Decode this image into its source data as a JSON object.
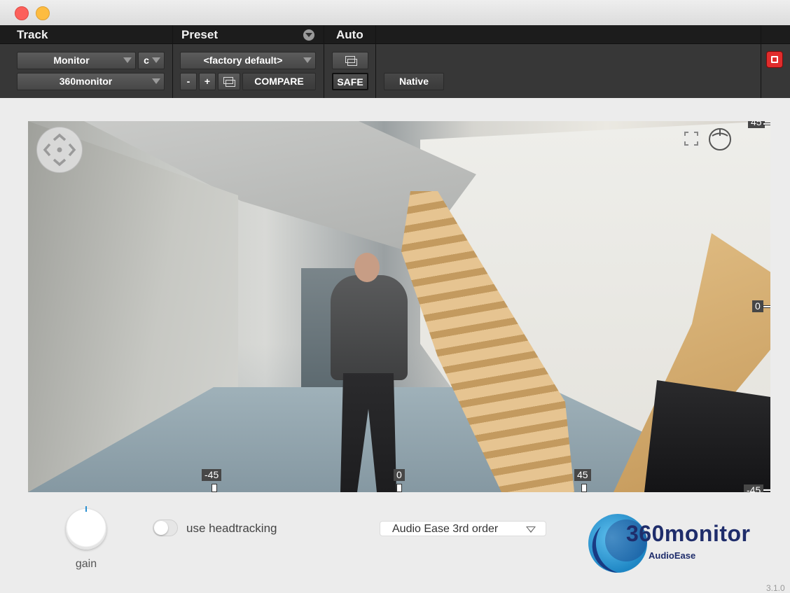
{
  "window": {
    "traffic_lights": [
      "close",
      "minimize"
    ]
  },
  "header": {
    "track_label": "Track",
    "preset_label": "Preset",
    "auto_label": "Auto",
    "track_select": "Monitor",
    "channel_select": "c",
    "plugin_select": "360monitor",
    "preset_select": "<factory default>",
    "minus_label": "-",
    "plus_label": "+",
    "compare_label": "COMPARE",
    "safe_label": "SAFE",
    "native_label": "Native",
    "bypass_color": "#e02c2c"
  },
  "viewer": {
    "ticks_bottom": [
      "-45",
      "0",
      "45"
    ],
    "ticks_right": [
      "45",
      "0",
      "-45"
    ]
  },
  "controls": {
    "gain_label": "gain",
    "headtracking_label": "use headtracking",
    "headtracking_on": false,
    "decoder_select": "Audio Ease 3rd order",
    "accent_color": "#2a8fd0"
  },
  "brand": {
    "logo_text": "360monitor",
    "logo_sub": "AudioEase",
    "version": "3.1.0"
  }
}
